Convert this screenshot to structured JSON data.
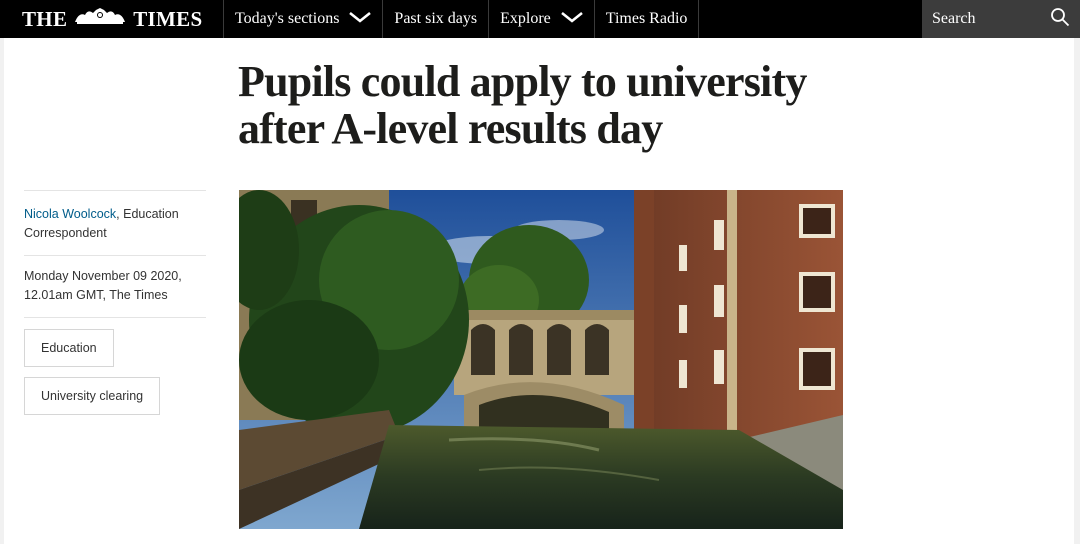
{
  "header": {
    "logo_left": "THE",
    "logo_right": "TIMES",
    "nav": [
      {
        "label": "Today's sections",
        "has_dropdown": true
      },
      {
        "label": "Past six days",
        "has_dropdown": false
      },
      {
        "label": "Explore",
        "has_dropdown": true
      },
      {
        "label": "Times Radio",
        "has_dropdown": false
      }
    ],
    "search_label": "Search"
  },
  "article": {
    "headline_line1": "Pupils could apply to university",
    "headline_line2": "after A-level results day",
    "author": "Nicola Woolcock",
    "author_role": ", Education Correspondent",
    "date": "Monday November 09 2020,",
    "time_source": "12.01am GMT, The Times",
    "tags": [
      "Education",
      "University clearing"
    ]
  },
  "colors": {
    "nav_bg": "#000000",
    "search_bg": "#3c3c3c",
    "author_link": "#005c8a"
  }
}
